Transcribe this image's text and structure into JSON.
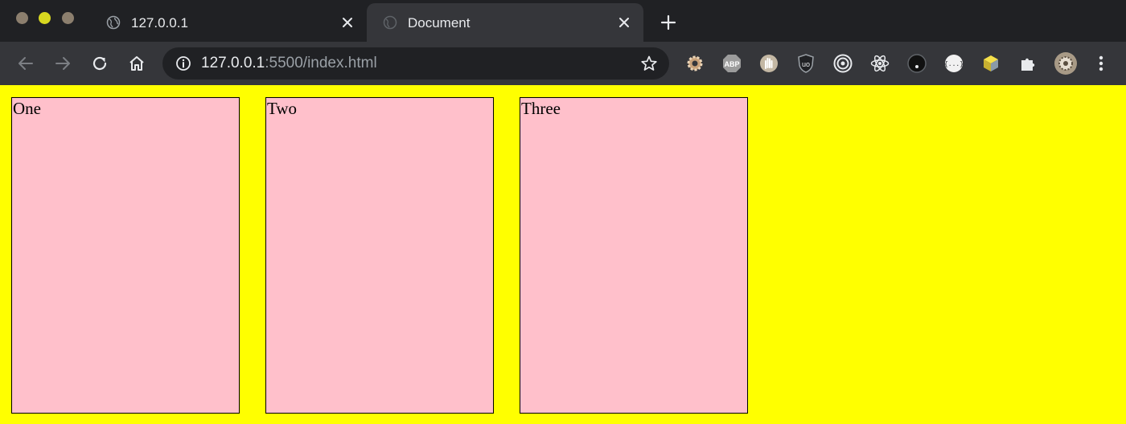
{
  "browser": {
    "tabs": [
      {
        "title": "127.0.0.1",
        "active": false,
        "icon": "globe-icon"
      },
      {
        "title": "Document",
        "active": true,
        "icon": "loading-globe-icon"
      }
    ],
    "toolbar": {
      "url_host": "127.0.0.1",
      "url_path": ":5500/index.html",
      "extensions": [
        "gear-extension-icon",
        "adblock-plus-icon",
        "hand-stop-icon",
        "ublock-origin-icon",
        "target-circle-icon",
        "react-devtools-icon",
        "dark-circle-icon",
        "json-viewer-icon",
        "cube-extension-icon",
        "puzzle-extensions-icon",
        "profile-avatar-icon",
        "kebab-menu-icon"
      ]
    }
  },
  "page": {
    "background": "#ffff00",
    "box_color": "#ffc0cb",
    "boxes": [
      "One",
      "Two",
      "Three"
    ]
  }
}
